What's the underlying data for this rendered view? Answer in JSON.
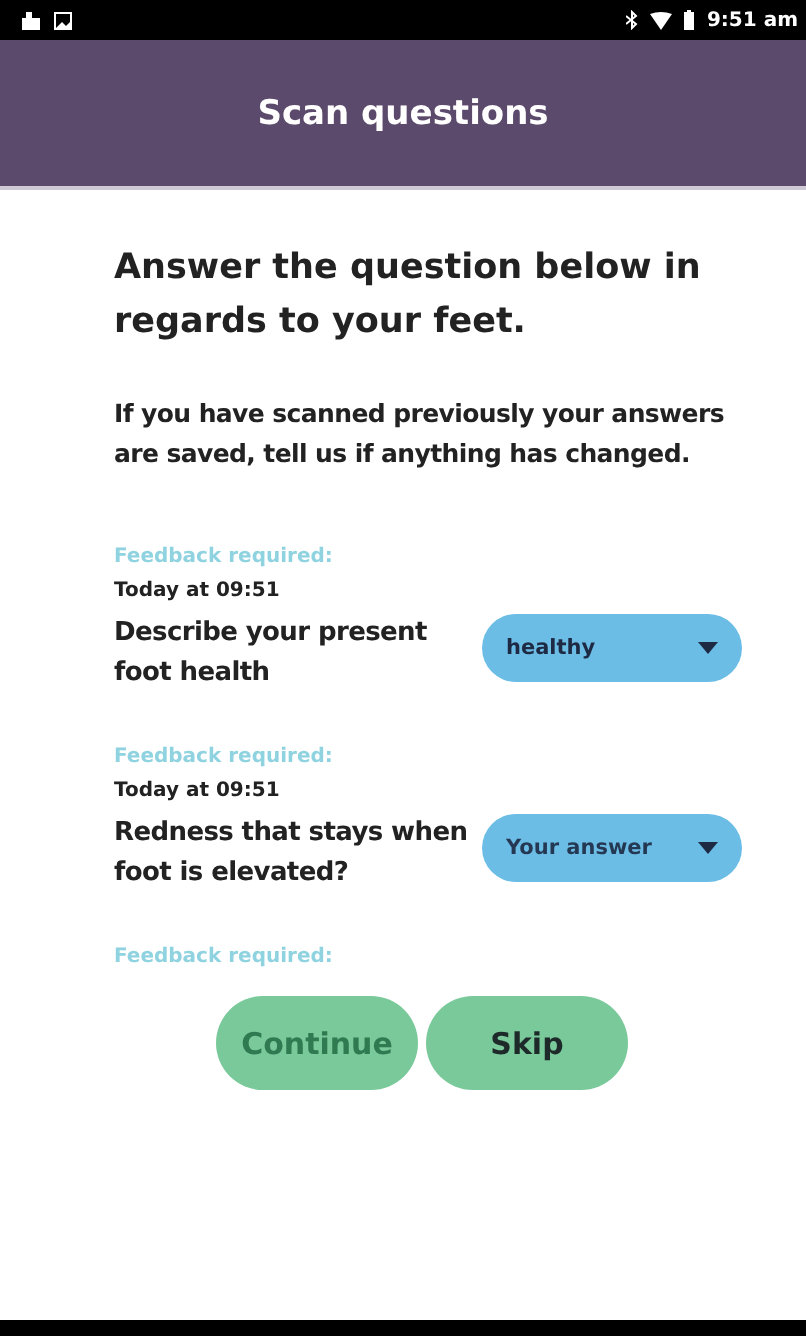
{
  "status_bar": {
    "time": "9:51 am"
  },
  "header": {
    "title": "Scan questions"
  },
  "heading": "Answer the question below in regards to your feet.",
  "intro": "If you have scanned previously your answers are saved, tell us if anything has changed.",
  "questions": [
    {
      "feedback": "Feedback required:",
      "time": "Today at 09:51",
      "text": "Describe your present foot health",
      "answer": {
        "value": "healthy"
      }
    },
    {
      "feedback": "Feedback required:",
      "time": "Today at 09:51",
      "text": "Redness that stays when foot is elevated?",
      "answer": {
        "placeholder": "Your answer"
      }
    },
    {
      "feedback": "Feedback required:"
    }
  ],
  "buttons": [
    {
      "label": "Continue",
      "disabled": true
    },
    {
      "label": "Skip",
      "disabled": false
    }
  ]
}
